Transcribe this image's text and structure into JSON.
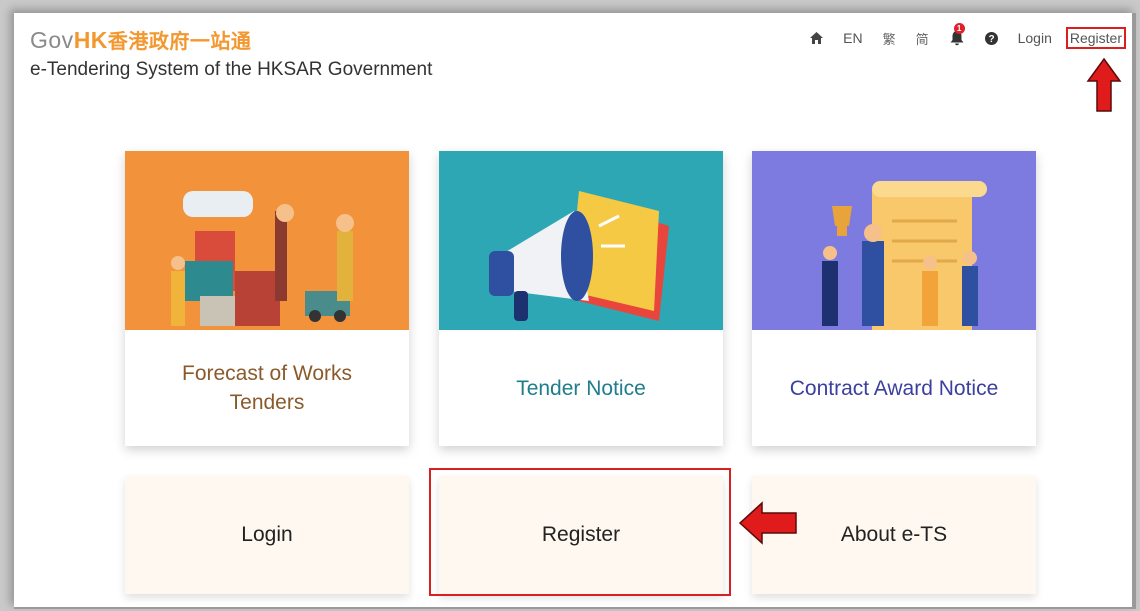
{
  "header": {
    "logo_gov": "Gov",
    "logo_hk": "HK",
    "logo_cn": "香港政府一站通",
    "subtitle": "e-Tendering System of the HKSAR Government"
  },
  "topnav": {
    "lang_en": "EN",
    "lang_tc": "繁",
    "lang_sc": "简",
    "notification_count": "1",
    "login": "Login",
    "register": "Register"
  },
  "cards": [
    {
      "label": "Forecast of Works Tenders",
      "color": "#8b5a2b",
      "bg": "#f2923a"
    },
    {
      "label": "Tender Notice",
      "color": "#1f7d8c",
      "bg": "#2ea7b5"
    },
    {
      "label": "Contract Award Notice",
      "color": "#3b3f9e",
      "bg": "#7d7be0"
    }
  ],
  "tiles": {
    "login": "Login",
    "register": "Register",
    "about": "About e-TS"
  },
  "colors": {
    "accent": "#f3972f",
    "highlight": "#d92020",
    "tile_bg": "#fef8f0"
  }
}
